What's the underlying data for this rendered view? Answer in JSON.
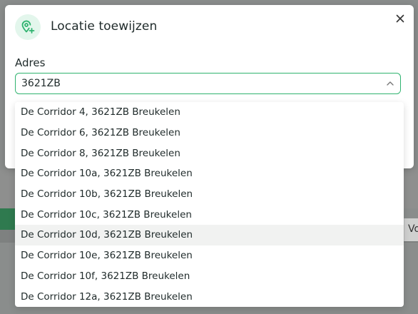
{
  "modal": {
    "title": "Locatie toewijzen",
    "icon": "location-pin-plus-icon",
    "close_icon": "close-icon"
  },
  "field": {
    "label": "Adres",
    "value": "3621ZB"
  },
  "background": {
    "partial_text": "Vo"
  },
  "options": [
    "De Corridor 4, 3621ZB Breukelen",
    "De Corridor 6, 3621ZB Breukelen",
    "De Corridor 8, 3621ZB Breukelen",
    "De Corridor 10a, 3621ZB Breukelen",
    "De Corridor 10b, 3621ZB Breukelen",
    "De Corridor 10c, 3621ZB Breukelen",
    "De Corridor 10d, 3621ZB Breukelen",
    "De Corridor 10e, 3621ZB Breukelen",
    "De Corridor 10f, 3621ZB Breukelen",
    "De Corridor 12a, 3621ZB Breukelen"
  ],
  "highlighted_option_index": 6,
  "colors": {
    "accent": "#2fb36f",
    "icon_bg": "#e3f6ec",
    "hover_bg": "#f1f2f1"
  }
}
